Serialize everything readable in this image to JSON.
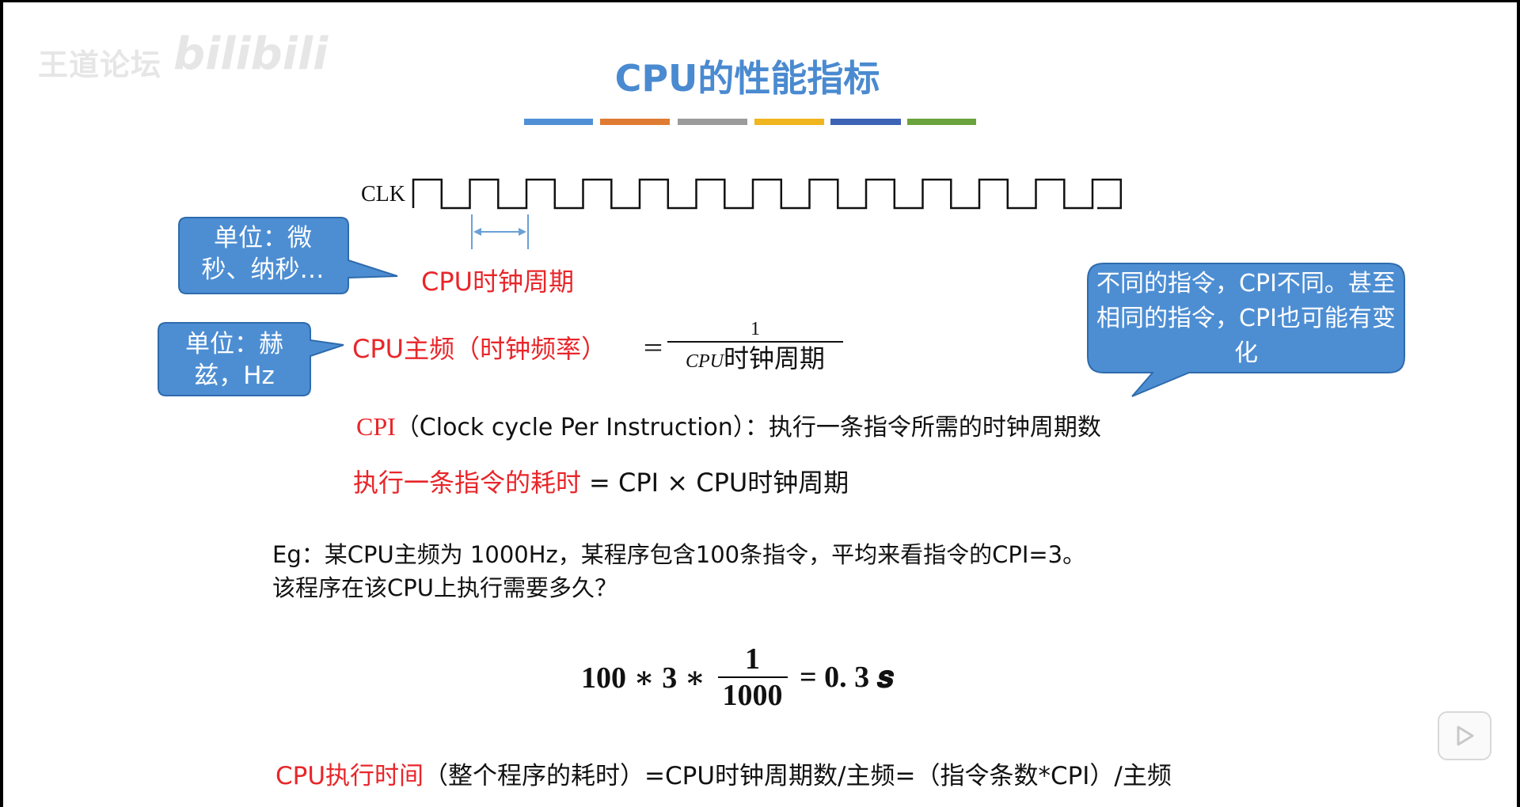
{
  "watermark": {
    "channel": "王道论坛",
    "site": "bilibili"
  },
  "title": "CPU的性能指标",
  "color_bars": [
    "#4f8fd6",
    "#e07b33",
    "#9b9b9b",
    "#f0b51f",
    "#3d63b5",
    "#6ba33d"
  ],
  "clock": {
    "label": "CLK"
  },
  "labels": {
    "clock_period": "CPU时钟周期",
    "freq_lhs": "CPU主频（时钟频率）",
    "freq_eq": "＝",
    "freq_num": "1",
    "freq_den_italic": "CPU",
    "freq_den_text": "时钟周期",
    "cpi_term": "CPI",
    "cpi_definition": "（Clock cycle Per Instruction）：执行一条指令所需的时钟周期数",
    "exec_time_term": "执行一条指令的耗时",
    "exec_time_formula": "= CPI × CPU时钟周期"
  },
  "callouts": {
    "unit_period": "单位：微秒、纳秒…",
    "unit_freq": "单位：赫兹，Hz",
    "cpi_note": "不同的指令，CPI不同。甚至相同的指令，CPI也可能有变化"
  },
  "example": {
    "line1": "Eg：某CPU主频为 1000Hz，某程序包含100条指令，平均来看指令的CPI=3。",
    "line2": "该程序在该CPU上执行需要多久？"
  },
  "formula": {
    "left": "100 ∗ 3 ∗",
    "num": "1",
    "den": "1000",
    "right": "= 0. 3 𝒔"
  },
  "summary": {
    "term": "CPU执行时间",
    "rest": "（整个程序的耗时）=CPU时钟周期数/主频=（指令条数*CPI）/主频"
  },
  "icons": {
    "play": "play-icon"
  }
}
